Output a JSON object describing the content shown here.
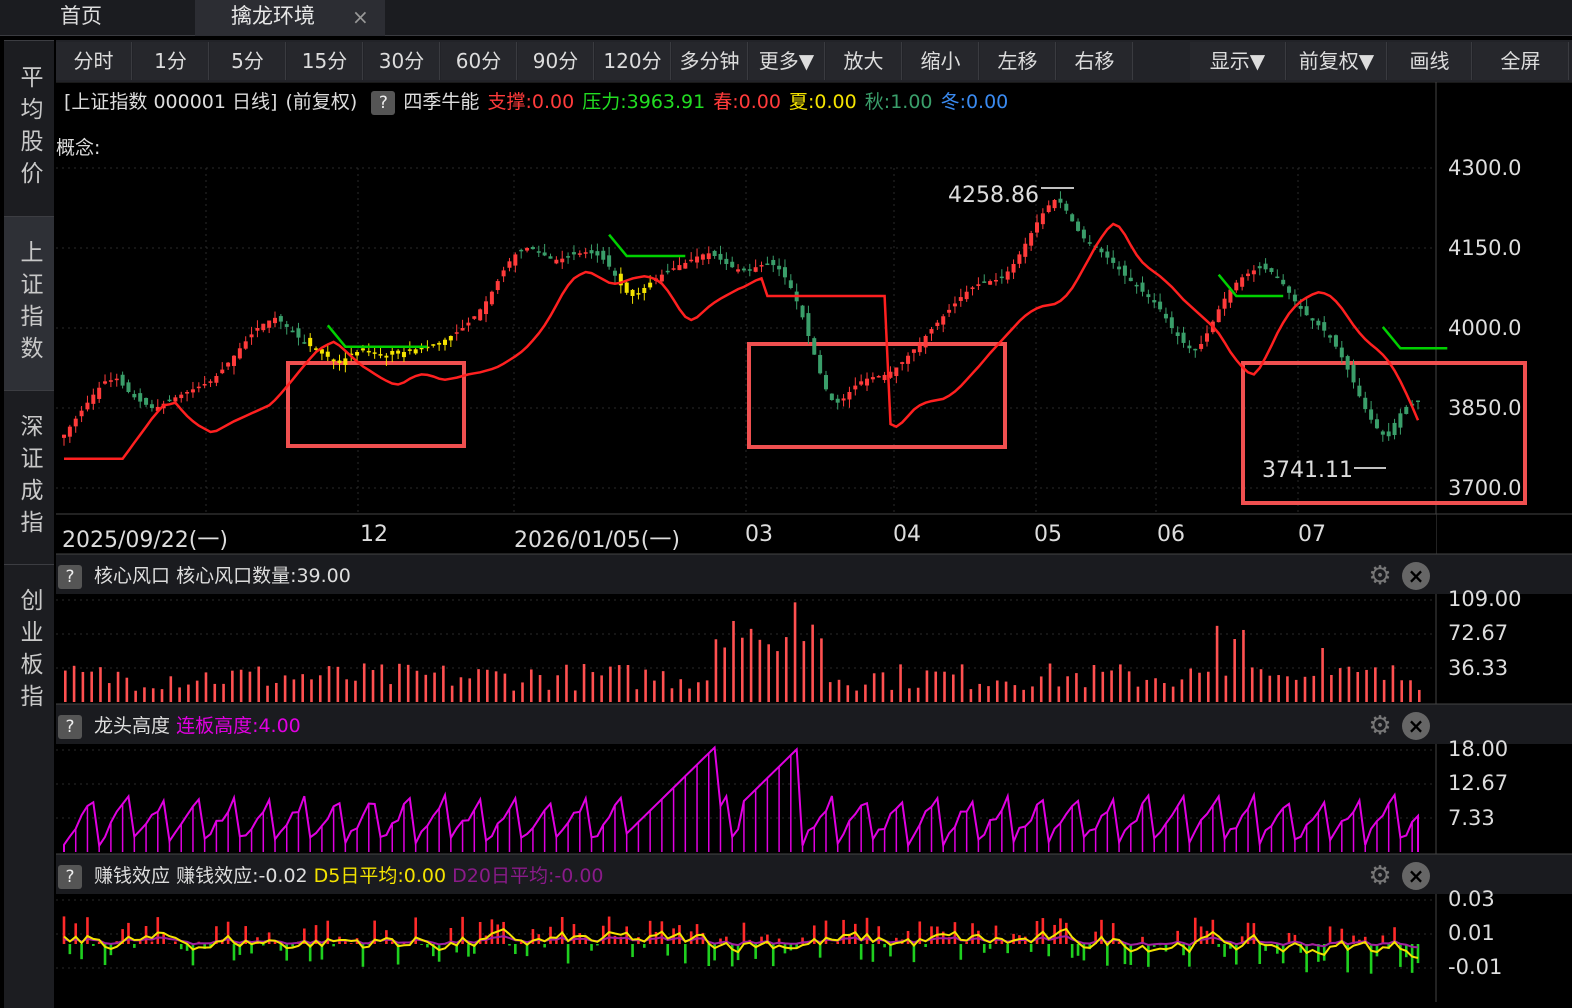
{
  "tabs": {
    "home": "首页",
    "env": "擒龙环境",
    "close": "×"
  },
  "sidebar": [
    "平均股价",
    "上证指数",
    "深证成指",
    "创业板指"
  ],
  "toolbar": [
    "分时",
    "1分",
    "5分",
    "15分",
    "30分",
    "60分",
    "90分",
    "120分",
    "多分钟",
    "更多▼",
    "放大",
    "缩小",
    "左移",
    "右移",
    "显示▼",
    "前复权▼",
    "画线",
    "全屏"
  ],
  "title_bar": {
    "instrument": "[上证指数 000001 日线]",
    "adjust": "(前复权)",
    "help": "?",
    "indicator": "四季牛能",
    "support": "支撑:0.00",
    "pressure": "压力:3963.91",
    "spring": "春:0.00",
    "summer": "夏:0.00",
    "autumn": "秋:1.00",
    "winter": "冬:0.00"
  },
  "concept_label": "概念:",
  "colors": {
    "up": "#ff3b3b",
    "down": "#3a9e6a",
    "yellow": "#f4e300",
    "green_line": "#00d000",
    "red_line": "#ff2020",
    "magenta": "#e000e0",
    "box": "#f05050"
  },
  "chart_data": [
    {
      "type": "candlestick",
      "y_ticks": [
        "4300.0",
        "4150.0",
        "4000.0",
        "3850.0",
        "3700.0"
      ],
      "ylim": [
        3700,
        4300
      ],
      "x_ticks": [
        "2025/09/22(一)",
        "12",
        "2026/01/05(一)",
        "03",
        "04",
        "05",
        "06",
        "07"
      ],
      "annotations": {
        "high": "4258.86",
        "low": "3741.11"
      },
      "closes": [
        3800,
        3815,
        3830,
        3845,
        3860,
        3875,
        3888,
        3900,
        3902,
        3905,
        3892,
        3880,
        3870,
        3862,
        3856,
        3850,
        3852,
        3858,
        3864,
        3870,
        3875,
        3880,
        3885,
        3890,
        3895,
        3900,
        3910,
        3922,
        3935,
        3948,
        3962,
        3975,
        3988,
        4000,
        4008,
        4014,
        4019,
        4012,
        4002,
        3992,
        3982,
        3973,
        3966,
        3959,
        3952,
        3946,
        3941,
        3939,
        3943,
        3950,
        3955,
        3958,
        3957,
        3954,
        3950,
        3948,
        3950,
        3952,
        3955,
        3958,
        3960,
        3962,
        3965,
        3968,
        3972,
        3978,
        3985,
        3992,
        4000,
        4010,
        4022,
        4035,
        4050,
        4068,
        4088,
        4108,
        4125,
        4138,
        4145,
        4150,
        4148,
        4142,
        4136,
        4130,
        4128,
        4130,
        4134,
        4138,
        4140,
        4142,
        4140,
        4136,
        4128,
        4115,
        4098,
        4080,
        4066,
        4060,
        4065,
        4075,
        4085,
        4093,
        4100,
        4106,
        4112,
        4118,
        4122,
        4128,
        4134,
        4138,
        4140,
        4135,
        4128,
        4120,
        4114,
        4110,
        4108,
        4110,
        4114,
        4118,
        4120,
        4118,
        4110,
        4095,
        4075,
        4050,
        4020,
        3985,
        3950,
        3915,
        3885,
        3865,
        3860,
        3868,
        3880,
        3892,
        3900,
        3905,
        3908,
        3910,
        3912,
        3918,
        3926,
        3936,
        3948,
        3960,
        3972,
        3985,
        3998,
        4010,
        4022,
        4034,
        4046,
        4058,
        4068,
        4076,
        4082,
        4086,
        4088,
        4090,
        4096,
        4106,
        4120,
        4138,
        4158,
        4178,
        4198,
        4215,
        4230,
        4240,
        4235,
        4220,
        4200,
        4182,
        4168,
        4158,
        4150,
        4142,
        4132,
        4122,
        4110,
        4098,
        4088,
        4078,
        4068,
        4058,
        4048,
        4035,
        4018,
        4000,
        3985,
        3972,
        3962,
        3958,
        3970,
        3990,
        4012,
        4035,
        4055,
        4072,
        4085,
        4095,
        4102,
        4108,
        4112,
        4110,
        4105,
        4095,
        4082,
        4066,
        4050,
        4036,
        4024,
        4014,
        4005,
        3995,
        3982,
        3965,
        3945,
        3922,
        3898,
        3872,
        3848,
        3828,
        3812,
        3800,
        3806,
        3822,
        3840,
        3852,
        3858,
        3862
      ]
    },
    {
      "type": "bar",
      "title": "核心风口",
      "label": "核心风口数量:39.00",
      "y_ticks": [
        "109.00",
        "72.67",
        "36.33"
      ],
      "ylim": [
        0,
        109
      ]
    },
    {
      "type": "bar",
      "title": "龙头高度",
      "label": "连板高度:4.00",
      "y_ticks": [
        "18.00",
        "12.67",
        "7.33"
      ],
      "ylim": [
        2,
        18
      ]
    },
    {
      "type": "bar",
      "title": "赚钱效应",
      "label": "赚钱效应:-0.02",
      "d5": "D5日平均:0.00",
      "d20": "D20日平均:-0.00",
      "y_ticks": [
        "0.03",
        "0.01",
        "-0.01"
      ],
      "ylim": [
        -0.03,
        0.04
      ]
    }
  ]
}
